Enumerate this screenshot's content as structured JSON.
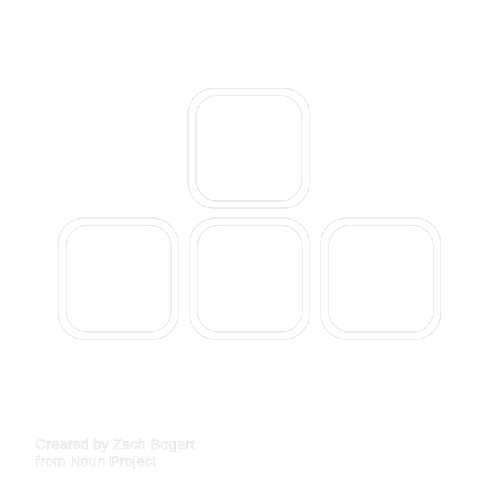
{
  "icon": {
    "name": "arrow-keys-icon",
    "stroke_color": "#e3e3e3",
    "background_color": "#ffffff"
  },
  "attribution": {
    "line1": "Created by Zach Bogart",
    "line2": "from Noun Project",
    "text_stroke_color": "#d8d8d8"
  }
}
